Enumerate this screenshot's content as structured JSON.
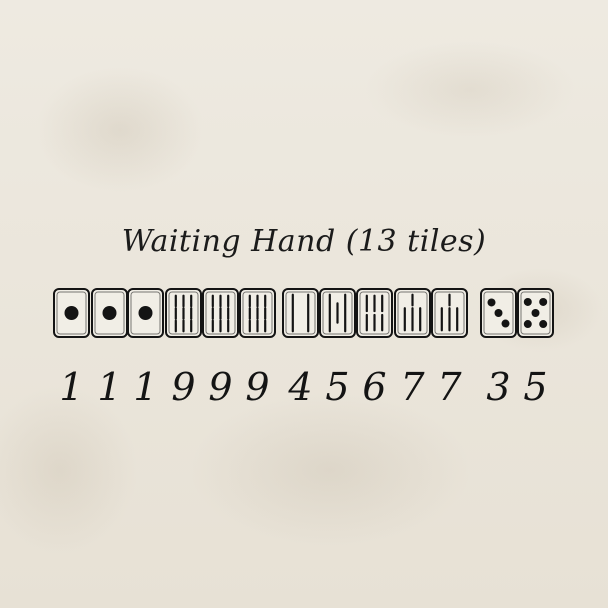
{
  "title": "Waiting Hand (13 tiles)",
  "tiles": [
    {
      "suit": "dots",
      "value": 1,
      "label": "1"
    },
    {
      "suit": "dots",
      "value": 1,
      "label": "1"
    },
    {
      "suit": "dots",
      "value": 1,
      "label": "1"
    },
    {
      "suit": "bamboo",
      "value": 9,
      "label": "9"
    },
    {
      "suit": "bamboo",
      "value": 9,
      "label": "9"
    },
    {
      "suit": "bamboo",
      "value": 9,
      "label": "9"
    },
    {
      "suit": "bamboo",
      "value": 4,
      "label": "4"
    },
    {
      "suit": "bamboo",
      "value": 5,
      "label": "5"
    },
    {
      "suit": "bamboo",
      "value": 6,
      "label": "6"
    },
    {
      "suit": "bamboo",
      "value": 7,
      "label": "7"
    },
    {
      "suit": "bamboo",
      "value": 7,
      "label": "7"
    },
    {
      "suit": "dots",
      "value": 3,
      "label": "3"
    },
    {
      "suit": "dots",
      "value": 5,
      "label": "5"
    }
  ],
  "colors": {
    "ink": "#141414",
    "tile_face": "#f1eee6"
  }
}
